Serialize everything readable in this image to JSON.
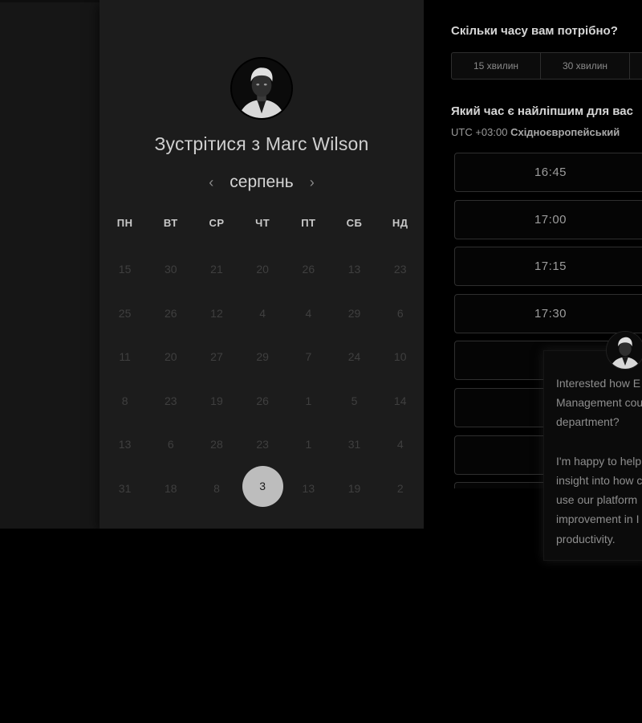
{
  "meeting": {
    "title_prefix": "Зустрітися з",
    "host_name": "Marc Wilson"
  },
  "calendar": {
    "month": "серпень",
    "prev_icon": "chevron-left-icon",
    "next_icon": "chevron-right-icon",
    "weekdays": [
      "ПН",
      "ВТ",
      "СР",
      "ЧТ",
      "ПТ",
      "СБ",
      "НД"
    ],
    "weeks": [
      [
        "15",
        "30",
        "21",
        "20",
        "26",
        "13",
        "23"
      ],
      [
        "25",
        "26",
        "12",
        "4",
        "4",
        "29",
        "6"
      ],
      [
        "11",
        "20",
        "27",
        "29",
        "7",
        "24",
        "10"
      ],
      [
        "8",
        "23",
        "19",
        "26",
        "1",
        "5",
        "14"
      ],
      [
        "13",
        "6",
        "28",
        "23",
        "1",
        "31",
        "4"
      ],
      [
        "31",
        "18",
        "8",
        "3",
        "13",
        "19",
        "2"
      ]
    ],
    "selected_day": "3"
  },
  "duration": {
    "title": "Скільки часу вам потрібно?",
    "options": [
      "15 хвилин",
      "30 хвилин",
      ""
    ]
  },
  "times": {
    "title": "Який час є найліпшим для вас",
    "timezone_offset": "UTC +03:00",
    "timezone_name": "Східноєвропейський",
    "slots": [
      "16:45",
      "17:00",
      "17:15",
      "17:30",
      "",
      "",
      "",
      ""
    ]
  },
  "chat": {
    "message": "Interested how E\nManagement cou\ndepartment?\n\nI'm happy to help\ninsight into how c\nuse our platform\nimprovement in I\nproductivity."
  },
  "colors": {
    "page_background": "#000000",
    "card_background": "#1c1c1c",
    "selected_day_background": "#bdbdbd"
  }
}
